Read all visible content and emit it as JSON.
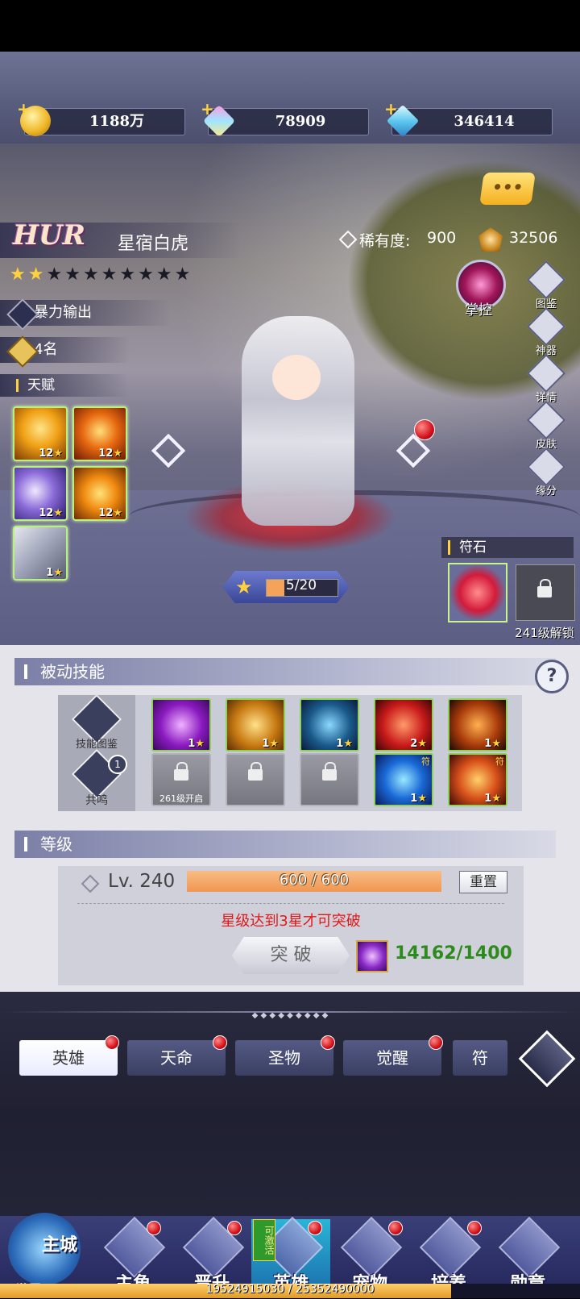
{
  "resources": [
    {
      "name": "gold",
      "value": "1188万"
    },
    {
      "name": "prism-gem",
      "value": "78909"
    },
    {
      "name": "diamond",
      "value": "346414"
    }
  ],
  "hero": {
    "rank": "HUR",
    "name": "星宿白虎",
    "rarity_label": "稀有度:",
    "rarity_value": "900",
    "power": "32506",
    "stars_filled": 2,
    "stars_total": 10,
    "role": "暴力输出",
    "rank_position": "4名",
    "talent_label": "天赋",
    "talent_levels": [
      "12",
      "12",
      "12",
      "12",
      "1"
    ],
    "control_label": "掌控",
    "star_progress": "5/20",
    "star_progress_fraction": 0.25
  },
  "side_buttons": [
    "图鉴",
    "神器",
    "详情",
    "皮肤",
    "缘分"
  ],
  "rune": {
    "title": "符石",
    "unlock_text": "241级解锁"
  },
  "passive": {
    "title": "被动技能",
    "help": "?",
    "left_buttons": [
      {
        "label": "技能图鉴"
      },
      {
        "label": "共鸣",
        "badge": "1"
      }
    ],
    "row1_levels": [
      "1",
      "1",
      "1",
      "2",
      "1"
    ],
    "row2_locked_text": "261级开启",
    "row2_levels": [
      "1",
      "1"
    ],
    "tag_glyph": "符"
  },
  "level": {
    "title": "等级",
    "lv_text": "Lv. 240",
    "exp_text": "600 / 600",
    "exp_fraction": 1.0,
    "reset_label": "重置",
    "warning": "星级达到3星才可突破",
    "break_label": "突 破",
    "cost": "14162/1400"
  },
  "tabs": [
    "英雄",
    "天命",
    "圣物",
    "觉醒",
    "符文"
  ],
  "tab_visible_text": [
    "英雄",
    "天命",
    "圣物",
    "觉醒",
    "符"
  ],
  "nav": {
    "home_top": "主城",
    "home_bottom": "世界",
    "items": [
      "主角",
      "晋升",
      "英雄",
      "宠物",
      "培养",
      "勋章"
    ],
    "hero_badge": "可激活"
  },
  "footer_exp": "19524915030 / 25352490000",
  "colors": {
    "accent_gold": "#ffd23b",
    "warning_red": "#e01818",
    "cost_green": "#2c8b1c",
    "exp_orange": "#f5a25a"
  }
}
